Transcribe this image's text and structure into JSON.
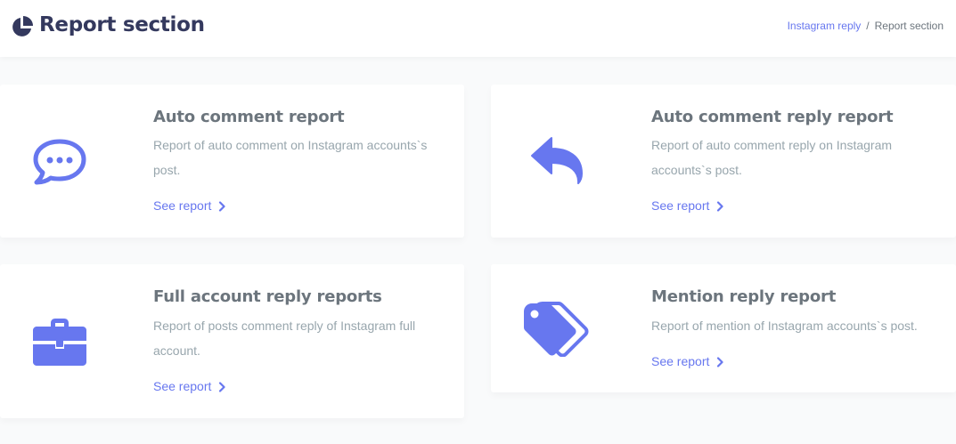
{
  "header": {
    "title": "Report section",
    "title_icon": "pie-chart-icon",
    "breadcrumb": [
      {
        "label": "Instagram reply"
      },
      {
        "label": "Report section"
      }
    ],
    "breadcrumb_separator": "/"
  },
  "colors": {
    "accent": "#6777ef",
    "heading": "#34395e",
    "muted": "#98a6ad"
  },
  "cards": [
    {
      "title": "Auto comment report",
      "description": "Report of auto comment on Instagram accounts`s post.",
      "link": "See report",
      "icon": "comment-dots-icon"
    },
    {
      "title": "Auto comment reply report",
      "description": "Report of auto comment reply on Instagram accounts`s post.",
      "link": "See report",
      "icon": "reply-icon"
    },
    {
      "title": "Full account reply reports",
      "description": "Report of posts comment reply of Instagram full account.",
      "link": "See report",
      "icon": "briefcase-icon"
    },
    {
      "title": "Mention reply report",
      "description": "Report of mention of Instagram accounts`s post.",
      "link": "See report",
      "icon": "tags-icon"
    }
  ]
}
